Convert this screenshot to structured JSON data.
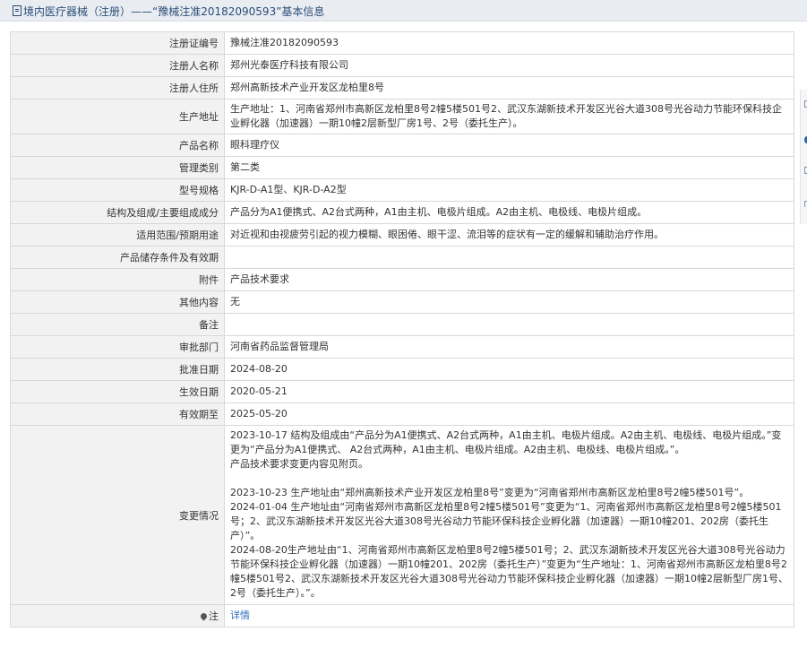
{
  "header": {
    "title": "境内医疗器械（注册）——“豫械注准20182090593”基本信息"
  },
  "rows": [
    {
      "label": "注册证编号",
      "value": "豫械注准20182090593"
    },
    {
      "label": "注册人名称",
      "value": "郑州光泰医疗科技有限公司"
    },
    {
      "label": "注册人住所",
      "value": "郑州高新技术产业开发区龙柏里8号"
    },
    {
      "label": "生产地址",
      "value": "生产地址：1、河南省郑州市高新区龙柏里8号2幢5楼501号2、武汉东湖新技术开发区光谷大道308号光谷动力节能环保科技企业孵化器（加速器）一期10幢2层新型厂房1号、2号（委托生产）。"
    },
    {
      "label": "产品名称",
      "value": "眼科理疗仪"
    },
    {
      "label": "管理类别",
      "value": "第二类"
    },
    {
      "label": "型号规格",
      "value": "KJR-D-A1型、KJR-D-A2型"
    },
    {
      "label": "结构及组成/主要组成成分",
      "value": "产品分为A1便携式、A2台式两种，A1由主机、电极片组成。A2由主机、电极线、电极片组成。"
    },
    {
      "label": "适用范围/预期用途",
      "value": "对近视和由视疲劳引起的视力模糊、眼困倦、眼干涩、流泪等的症状有一定的缓解和辅助治疗作用。"
    },
    {
      "label": "产品储存条件及有效期",
      "value": ""
    },
    {
      "label": "附件",
      "value": "产品技术要求"
    },
    {
      "label": "其他内容",
      "value": "无"
    },
    {
      "label": "备注",
      "value": ""
    },
    {
      "label": "审批部门",
      "value": "河南省药品监督管理局"
    },
    {
      "label": "批准日期",
      "value": "2024-08-20"
    },
    {
      "label": "生效日期",
      "value": "2020-05-21"
    },
    {
      "label": "有效期至",
      "value": "2025-05-20"
    }
  ],
  "changes": {
    "label": "变更情况",
    "lines": [
      "2023-10-17 结构及组成由“产品分为A1便携式、A2台式两种，A1由主机、电极片组成。A2由主机、电极线、电极片组成。”变更为“产品分为A1便携式、 A2台式两种，A1由主机、电极片组成。A2由主机、电极线、电极片组成。”。",
      "产品技术要求变更内容见附页。",
      "2023-10-23 生产地址由“郑州高新技术产业开发区龙柏里8号”变更为“河南省郑州市高新区龙柏里8号2幢5楼501号”。",
      "2024-01-04 生产地址由“河南省郑州市高新区龙柏里8号2幢5楼501号”变更为“1、河南省郑州市高新区龙柏里8号2幢5楼501号；2、武汉东湖新技术开发区光谷大道308号光谷动力节能环保科技企业孵化器（加速器）一期10幢201、202房（委托生产）”。",
      "2024-08-20生产地址由“1、河南省郑州市高新区龙柏里8号2幢5楼501号；2、武汉东湖新技术开发区光谷大道308号光谷动力节能环保科技企业孵化器（加速器）一期10幢201、202房（委托生产）”变更为“生产地址：1、河南省郑州市高新区龙柏里8号2幢5楼501号2、武汉东湖新技术开发区光谷大道308号光谷动力节能环保科技企业孵化器（加速器）一期10幢2层新型厂房1号、2号（委托生产）。”。"
    ]
  },
  "note": {
    "label": "注",
    "link": "详情"
  }
}
